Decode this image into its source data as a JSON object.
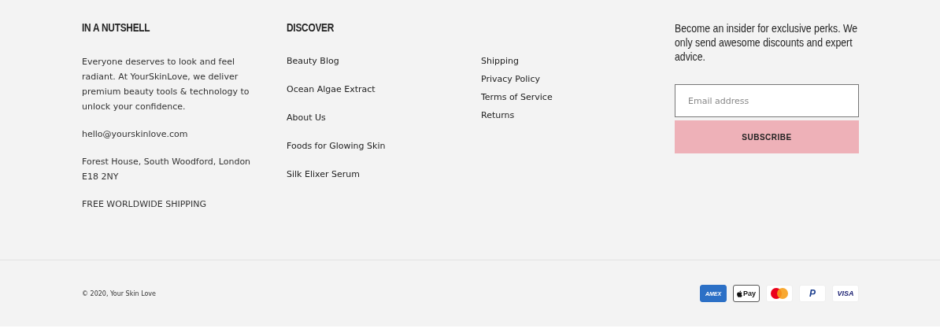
{
  "about": {
    "heading": "IN A NUTSHELL",
    "paragraphs": [
      "Everyone deserves to look and feel radiant. At YourSkinLove, we deliver premium beauty tools & technology to unlock your confidence.",
      "hello@yourskinlove.com",
      "Forest House, South Woodford, London E18 2NY",
      "FREE WORLDWIDE SHIPPING"
    ]
  },
  "discover": {
    "heading": "DISCOVER",
    "links": [
      "Beauty Blog",
      "Ocean Algae Extract",
      "About Us",
      "Foods for Glowing Skin",
      "Silk Elixer Serum"
    ]
  },
  "policies": {
    "links": [
      "Shipping",
      "Privacy Policy",
      "Terms of Service",
      "Returns"
    ]
  },
  "newsletter": {
    "text": "Become an insider for exclusive perks. We only send awesome discounts and expert advice.",
    "email_placeholder": "Email address",
    "button": "SUBSCRIBE"
  },
  "copyright": "© 2020, Your Skin Love",
  "payment_methods": [
    {
      "kind": "amex",
      "label": "AMEX"
    },
    {
      "kind": "applepay",
      "label": "Pay"
    },
    {
      "kind": "mastercard"
    },
    {
      "kind": "paypal",
      "label": "P"
    },
    {
      "kind": "visa",
      "label": "VISA"
    }
  ]
}
